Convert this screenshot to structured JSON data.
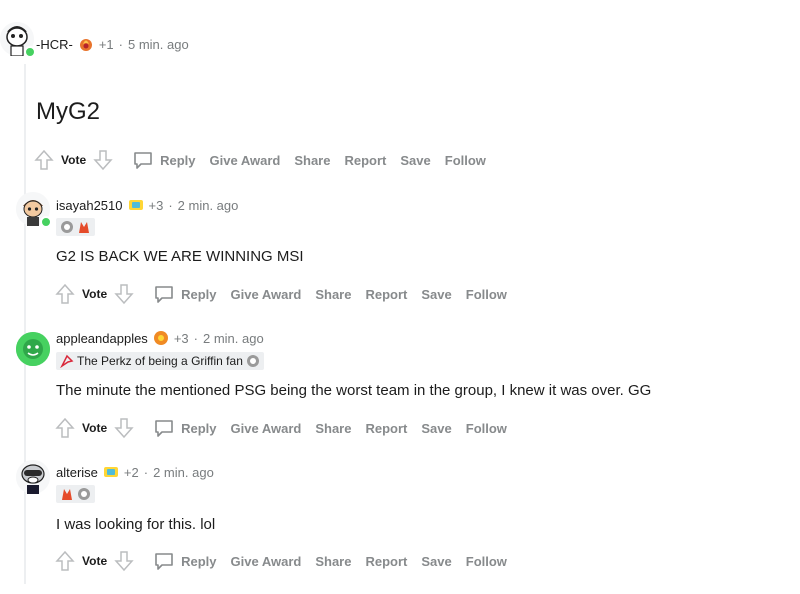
{
  "comments": [
    {
      "username": "-HCR-",
      "karma_change": "+1",
      "sep": "·",
      "time": "5 min. ago",
      "body": "MyG2",
      "award_icon": "fire-award-icon"
    },
    {
      "username": "isayah2510",
      "karma_change": "+3",
      "sep": "·",
      "time": "2 min. ago",
      "body": "G2 IS BACK WE ARE WINNING MSI",
      "award_icon": "trophy-award-icon",
      "flair_icons": [
        "g2-logo-icon",
        "flame-logo-icon"
      ]
    },
    {
      "username": "appleandapples",
      "karma_change": "+3",
      "sep": "·",
      "time": "2 min. ago",
      "body": "The minute the mentioned PSG being the worst team in the group, I knew it was over. GG",
      "award_icon": "flower-award-icon",
      "flair_text": "The Perkz of being a Griffin fan"
    },
    {
      "username": "alterise",
      "karma_change": "+2",
      "sep": "·",
      "time": "2 min. ago",
      "body": "I was looking for this. lol",
      "award_icon": "trophy-award-icon",
      "flair_icons": [
        "flame-logo-icon",
        "g2-logo-icon"
      ]
    }
  ],
  "actions": {
    "vote": "Vote",
    "reply": "Reply",
    "give_award": "Give Award",
    "share": "Share",
    "report": "Report",
    "save": "Save",
    "follow": "Follow"
  },
  "colors": {
    "online": "#46d160",
    "muted": "#878a8c",
    "text": "#1c1c1c",
    "flair_bg": "#edeff1"
  }
}
